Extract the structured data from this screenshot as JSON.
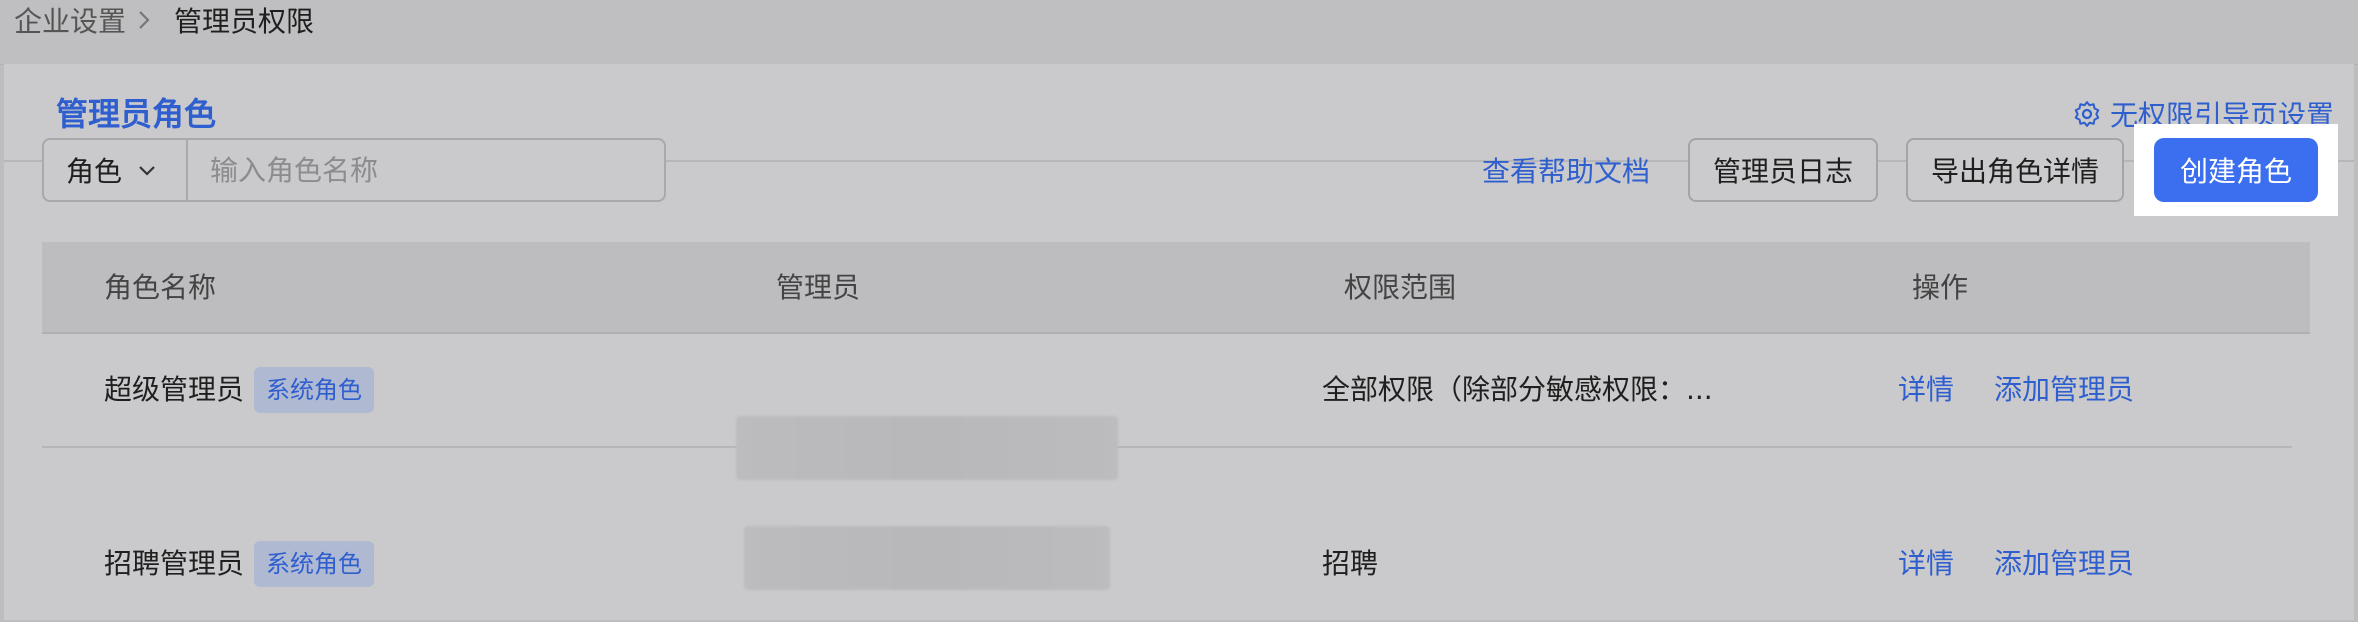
{
  "breadcrumb": {
    "parent": "企业设置",
    "current": "管理员权限"
  },
  "tabs": [
    {
      "label": "管理员角色"
    }
  ],
  "guide_link": {
    "label": "无权限引导页设置",
    "icon": "gear-icon"
  },
  "search": {
    "select_value": "角色",
    "placeholder": "输入角色名称"
  },
  "toolbar": {
    "help_label": "查看帮助文档",
    "log_label": "管理员日志",
    "export_label": "导出角色详情",
    "create_label": "创建角色"
  },
  "table": {
    "headers": [
      "角色名称",
      "管理员",
      "权限范围",
      "操作"
    ],
    "rows": [
      {
        "name": "超级管理员",
        "badge": "系统角色",
        "scope": "全部权限（除部分敏感权限：...",
        "actions": [
          "详情",
          "添加管理员"
        ]
      },
      {
        "name": "招聘管理员",
        "badge": "系统角色",
        "scope": "招聘",
        "actions": [
          "详情",
          "添加管理员"
        ]
      }
    ]
  },
  "colors": {
    "accent": "#3b6ff0",
    "link": "#2f5fcf"
  }
}
